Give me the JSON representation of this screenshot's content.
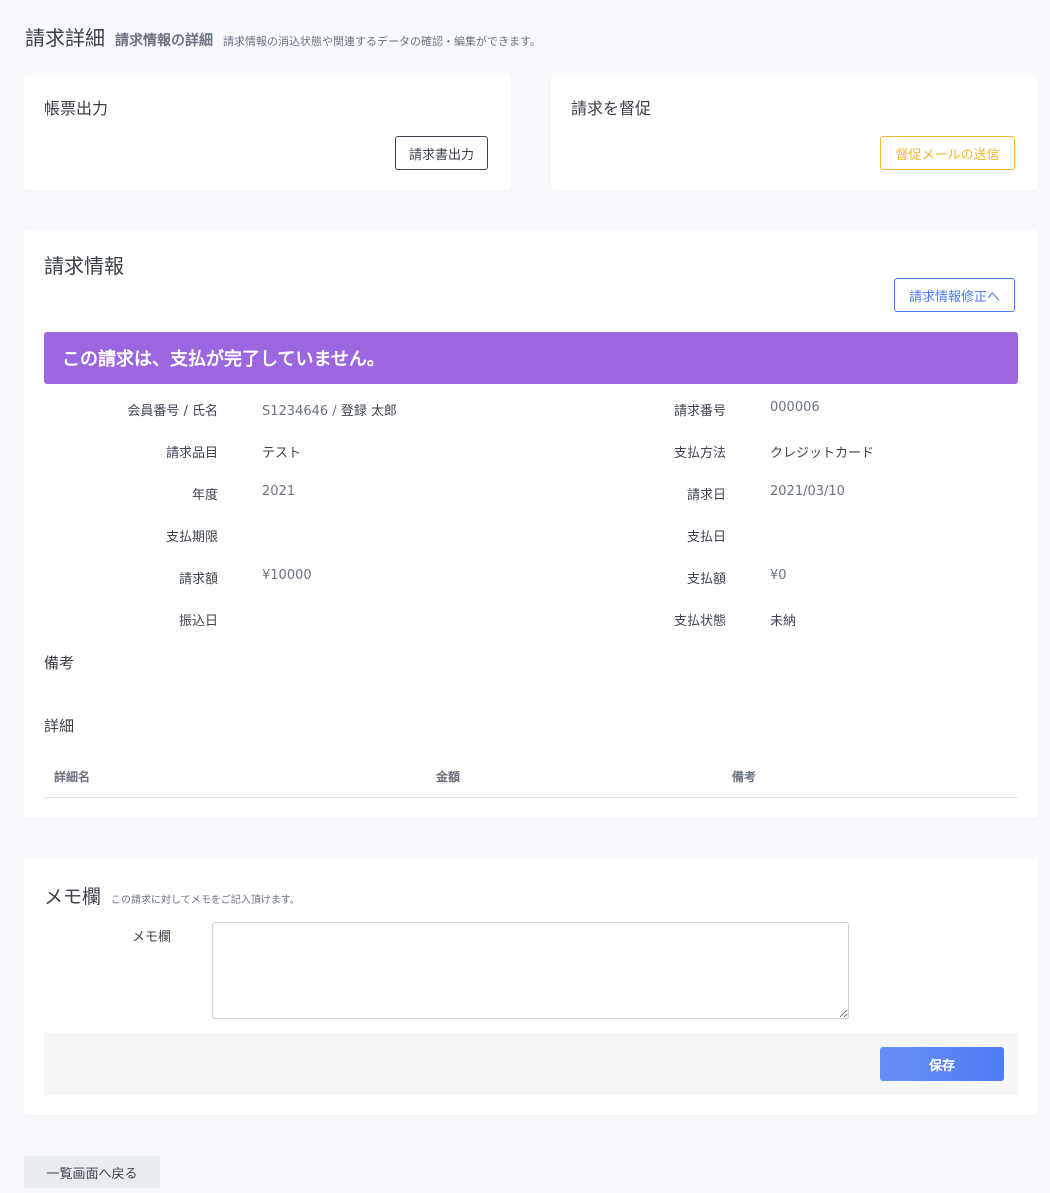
{
  "header": {
    "title": "請求詳細",
    "subtitle": "請求情報の詳細",
    "description": "請求情報の消込状態や関連するデータの確認・編集ができます。"
  },
  "report_card": {
    "title": "帳票出力",
    "button_label": "請求書出力"
  },
  "reminder_card": {
    "title": "請求を督促",
    "button_label": "督促メールの送信"
  },
  "billing_info": {
    "title": "請求情報",
    "edit_button_label": "請求情報修正へ",
    "alert_text": "この請求は、支払が完了していません。",
    "left_rows": [
      {
        "label": "会員番号 / 氏名",
        "value_id": "S1234646",
        "value_sep": " / ",
        "value_name": "登録 太郎"
      },
      {
        "label": "請求品目",
        "value": "テスト"
      },
      {
        "label": "年度",
        "value": "2021"
      },
      {
        "label": "支払期限",
        "value": ""
      },
      {
        "label": "請求額",
        "value": "¥10000"
      },
      {
        "label": "振込日",
        "value": ""
      }
    ],
    "right_rows": [
      {
        "label": "請求番号",
        "value": "000006"
      },
      {
        "label": "支払方法",
        "value": "クレジットカード"
      },
      {
        "label": "請求日",
        "value": "2021/03/10"
      },
      {
        "label": "支払日",
        "value": ""
      },
      {
        "label": "支払額",
        "value": "¥0"
      },
      {
        "label": "支払状態",
        "value": "未納"
      }
    ],
    "remarks_label": "備考",
    "details_label": "詳細",
    "details_columns": [
      "詳細名",
      "金額",
      "備考"
    ]
  },
  "memo": {
    "title": "メモ欄",
    "description": "この請求に対してメモをご記入頂けます。",
    "field_label": "メモ欄",
    "value": "",
    "save_label": "保存"
  },
  "back_button_label": "一覧画面へ戻る",
  "colors": {
    "alert_bg": "#9b66e0",
    "reminder_accent": "#f5b731",
    "edit_accent": "#4d7cf5",
    "save_bg": "#5a85f5"
  }
}
